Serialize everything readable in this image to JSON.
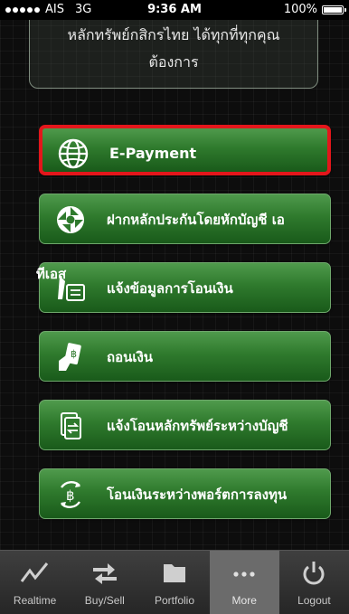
{
  "status_bar": {
    "carrier": "AIS",
    "network": "3G",
    "time": "9:36 AM",
    "battery": "100%",
    "battery_level": 1.0
  },
  "info_box": {
    "line1": "หลักทรัพย์กสิกรไทย ได้ทุกที่ทุกคุณ",
    "line2": "ต้องการ"
  },
  "menu": {
    "items": [
      {
        "label": "E-Payment",
        "icon": "globe-icon",
        "selected": true
      },
      {
        "label": "ฝากหลักประกันโดยหักบัญชี เอ",
        "icon": "shutter-icon"
      },
      {
        "label": "แจ้งข้อมูลการโอนเงิน",
        "icon": "transfer-form-icon"
      },
      {
        "label": "ถอนเงิน",
        "icon": "withdraw-cash-icon"
      },
      {
        "label": "แจ้งโอนหลักทรัพย์ระหว่างบัญชี",
        "icon": "document-transfer-icon"
      },
      {
        "label": "โอนเงินระหว่างพอร์ตการลงทุน",
        "icon": "baht-cycle-icon"
      }
    ],
    "overflow_text": "ทีเอส"
  },
  "tabbar": {
    "tabs": [
      {
        "label": "Realtime",
        "icon": "chart-line-icon"
      },
      {
        "label": "Buy/Sell",
        "icon": "buy-sell-arrows-icon"
      },
      {
        "label": "Portfolio",
        "icon": "folder-icon"
      },
      {
        "label": "More",
        "icon": "ellipsis-icon",
        "active": true
      },
      {
        "label": "Logout",
        "icon": "power-icon"
      }
    ]
  },
  "colors": {
    "selected_border": "#e3161b",
    "button_green": "#2f7a2d",
    "active_tab": "#6b6b6b"
  }
}
